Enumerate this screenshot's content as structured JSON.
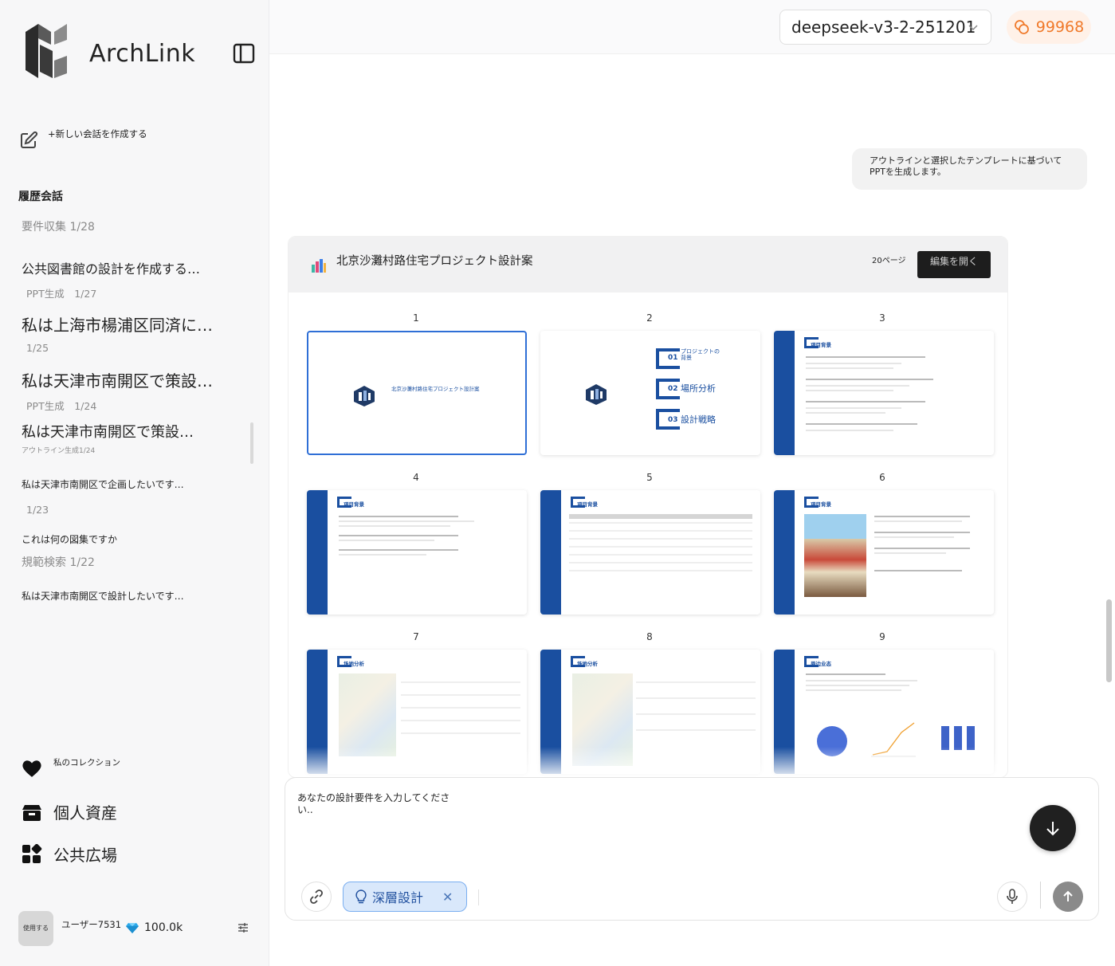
{
  "brand": {
    "name": "ArchLink"
  },
  "sidebar": {
    "new_chat_label": "+新しい会話を作成する",
    "history_title": "履歴会話",
    "history": [
      {
        "title": "…",
        "meta": "要件収集 1/28"
      },
      {
        "title": "公共図書館の設計を作成する…",
        "meta": "PPT生成　1/27"
      },
      {
        "title": "私は上海市楊浦区同済に…",
        "meta": "1/25"
      },
      {
        "title": "私は天津市南開区で策設…",
        "meta": "PPT生成　1/24"
      },
      {
        "title": "私は天津市南開区で策設…",
        "meta": "アウトライン生成1/24"
      },
      {
        "title": "私は天津市南開区で企画したいです…",
        "meta": "1/23"
      },
      {
        "title": "これは何の図集ですか",
        "meta": "規範検索 1/22"
      },
      {
        "title": "私は天津市南開区で設計したいです…",
        "meta": ""
      }
    ],
    "nav": [
      {
        "label": "私のコレクション",
        "icon": "heart-icon"
      },
      {
        "label": "個人資産",
        "icon": "box-icon"
      },
      {
        "label": "公共広場",
        "icon": "grid-icon"
      }
    ],
    "user": {
      "avatar_text": "使用する",
      "name": "ユーザー7531",
      "credits": "100.0k"
    }
  },
  "header": {
    "model": "deepseek-v3-2-251201",
    "points": "99968"
  },
  "chat": {
    "user_message": "アウトラインと選択したテンプレートに基づいてPPTを生成します。"
  },
  "ppt": {
    "title": "北京沙灘村路住宅プロジェクト設計案",
    "pages": "20ページ",
    "edit_label": "編集を開く",
    "slides": [
      {
        "num": "1",
        "text": "北京沙灘村路住宅プロジェクト設計案"
      },
      {
        "num": "2",
        "items": [
          "01",
          "プロジェクトの背景",
          "02",
          "場所分析",
          "03",
          "設計戦略"
        ]
      },
      {
        "num": "3",
        "text": "項目背景"
      },
      {
        "num": "4",
        "text": "項目背景"
      },
      {
        "num": "5",
        "text": "項目背景"
      },
      {
        "num": "6",
        "text": "項目背景"
      },
      {
        "num": "7",
        "text": "场地分析"
      },
      {
        "num": "8",
        "text": "场地分析"
      },
      {
        "num": "9",
        "text": "周边业态"
      }
    ]
  },
  "composer": {
    "placeholder": "あなたの設計要件を入力してください..",
    "chip_label": "深層設計"
  },
  "colors": {
    "accent": "#1a4fa0",
    "points": "#f07a2b",
    "chip_bg": "#d9e8fb"
  }
}
